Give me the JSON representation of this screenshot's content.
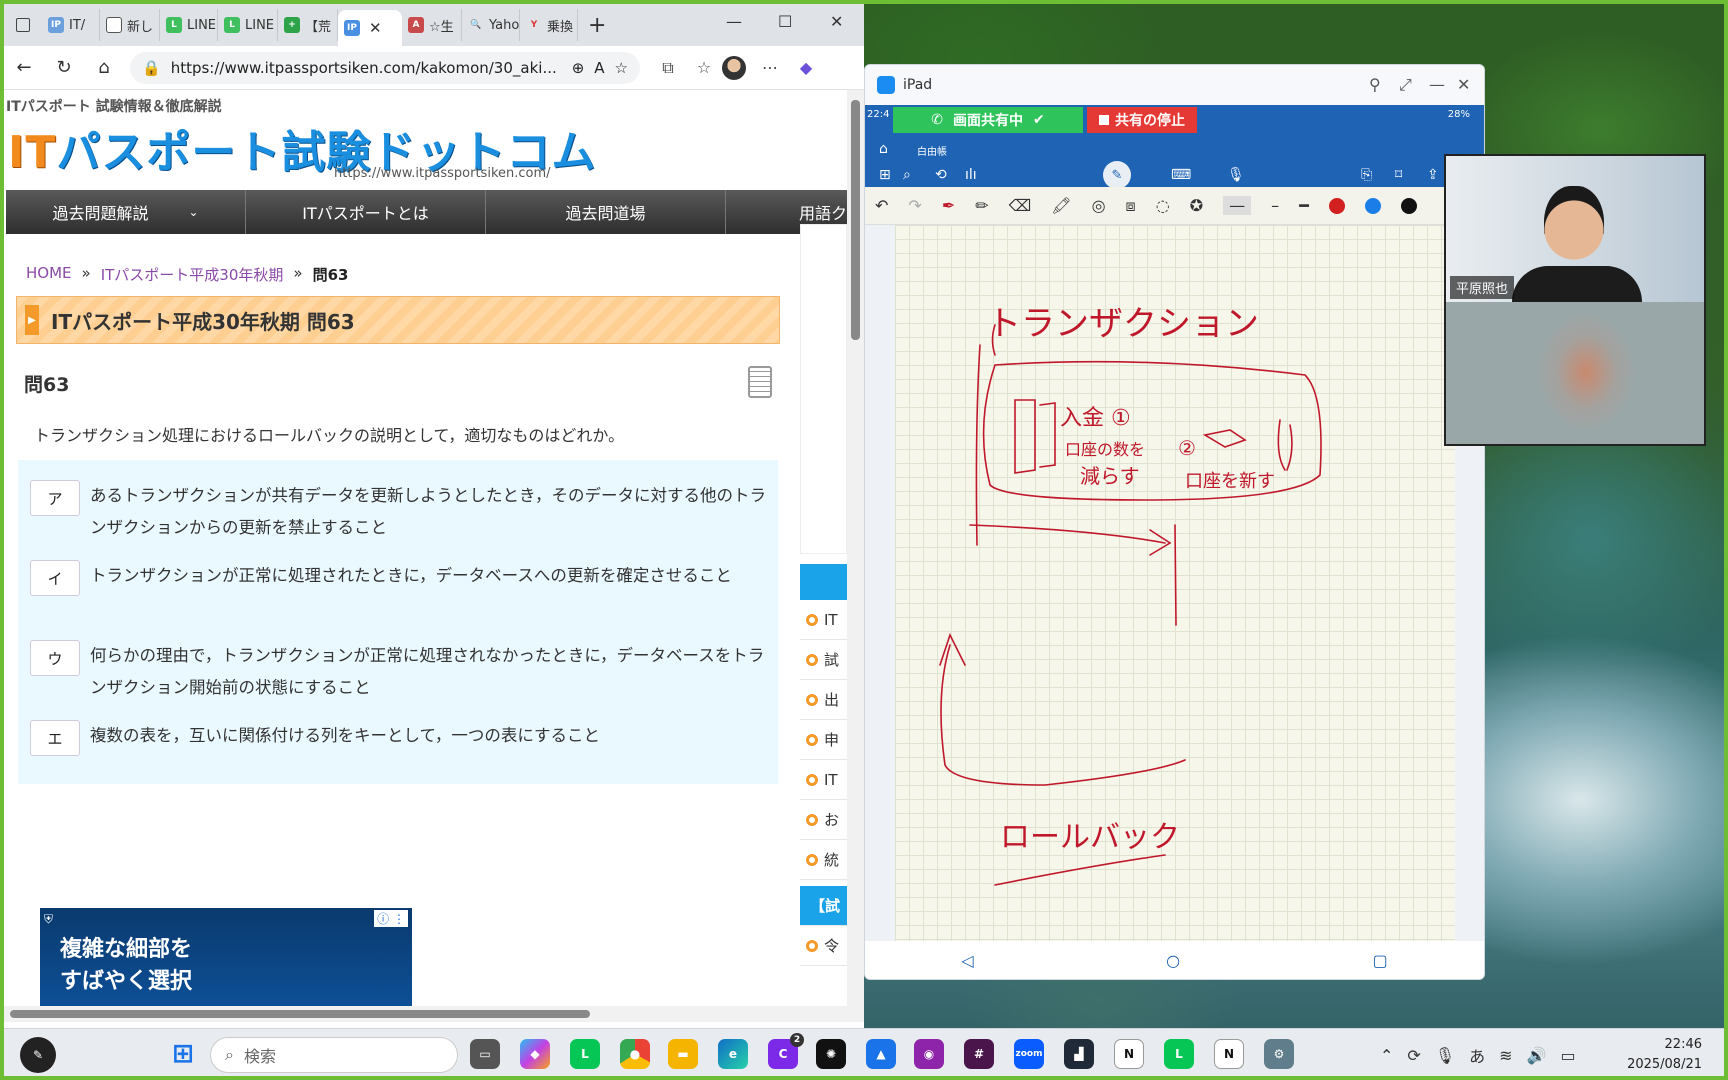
{
  "browser": {
    "tabs": [
      {
        "label": "IT/"
      },
      {
        "label": "新し"
      },
      {
        "label": "LINE"
      },
      {
        "label": "LINE"
      },
      {
        "label": "【荒"
      },
      {
        "label": "IP",
        "active": true
      },
      {
        "label": "☆生"
      },
      {
        "label": "Yaho"
      },
      {
        "label": "乗換"
      }
    ],
    "url": "https://www.itpassportsiken.com/kakomon/30_aki...",
    "address_icons": {
      "back": "arrow-left-icon",
      "refresh": "refresh-icon",
      "home": "home-icon",
      "lock": "lock-icon"
    }
  },
  "site": {
    "subtitle": "ITパスポート 試験情報＆徹底解説",
    "logo_it": "IT",
    "logo_rest": "パスポート試験ドットコム",
    "logo_url": "https://www.itpassportsiken.com/",
    "menu": [
      "過去問題解説",
      "ITパスポートとは",
      "過去問道場",
      "用語ク"
    ],
    "breadcrumb": {
      "home": "HOME",
      "sep": "»",
      "parent": "ITパスポート平成30年秋期",
      "current": "問63"
    },
    "title": "ITパスポート平成30年秋期 問63",
    "qnum": "問63",
    "question": "トランザクション処理におけるロールバックの説明として，適切なものはどれか。",
    "choices": [
      {
        "key": "ア",
        "text": "あるトランザクションが共有データを更新しようとしたとき，そのデータに対する他のトランザクションからの更新を禁止すること"
      },
      {
        "key": "イ",
        "text": "トランザクションが正常に処理されたときに，データベースへの更新を確定させること"
      },
      {
        "key": "ウ",
        "text": "何らかの理由で，トランザクションが正常に処理されなかったときに，データベースをトランザクション開始前の状態にすること"
      },
      {
        "key": "エ",
        "text": "複数の表を，互いに関係付ける列をキーとして，一つの表にすること"
      }
    ],
    "sidebar": [
      "IT",
      "試",
      "出",
      "申",
      "IT",
      "お",
      "統",
      "【試",
      "令"
    ],
    "ad": {
      "line1": "複雑な細部を",
      "line2": "すばやく選択"
    }
  },
  "ipad": {
    "title": "iPad",
    "time": "22:4",
    "battery": "28%",
    "share_on": "画面共有中",
    "share_stop": "共有の停止",
    "doc_name": "白由帳",
    "handwriting": {
      "title": "トランザクション",
      "item1": "入金 ①",
      "item1b": "口座の数を",
      "item1c": "減らす",
      "item2": "②",
      "item2b": "口座を新す",
      "bottom": "ロールバック"
    },
    "colors": {
      "red": "#d21f1f",
      "blue": "#1b7de8",
      "black": "#111111",
      "ink": "#c0182b"
    }
  },
  "video": {
    "participant": "平原照也"
  },
  "taskbar": {
    "search_placeholder": "検索",
    "badge": "2",
    "ime": "あ",
    "time": "22:46",
    "date": "2025/08/21"
  }
}
